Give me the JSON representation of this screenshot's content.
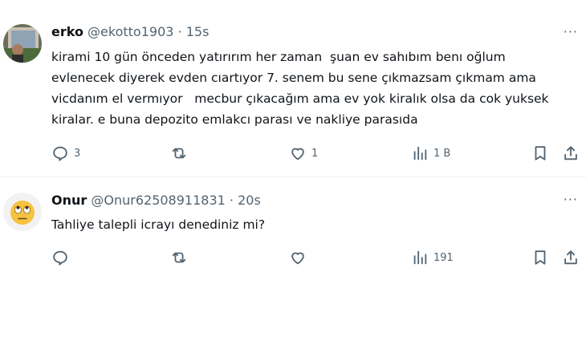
{
  "tweets": [
    {
      "name": "erko",
      "handle": "@ekotto1903",
      "separator": "·",
      "time": "15s",
      "text": "kirami 10 gün önceden yatırırım her zaman  şuan ev sahıbım benı oğlum evlenecek diyerek evden cıartıyor 7. senem bu sene çıkmazsam çıkmam ama vicdanım el vermıyor   mecbur çıkacağım ama ev yok kiralık olsa da cok yuksek kiralar. e buna depozito emlakcı parası ve nakliye parasıda",
      "replies": "3",
      "retweets": "",
      "likes": "1",
      "views": "1 B",
      "more": "···",
      "icons": {
        "reply": "reply-icon",
        "retweet": "retweet-icon",
        "like": "heart-icon",
        "views": "views-icon",
        "bookmark": "bookmark-icon",
        "share": "share-icon"
      }
    },
    {
      "name": "Onur",
      "handle": "@Onur62508911831",
      "separator": "·",
      "time": "20s",
      "text": "Tahliye talepli icrayı denediniz mi?",
      "replies": "",
      "retweets": "",
      "likes": "",
      "views": "191",
      "more": "···",
      "avatar_emoji": "🙄",
      "icons": {
        "reply": "reply-icon",
        "retweet": "retweet-icon",
        "like": "heart-icon",
        "views": "views-icon",
        "bookmark": "bookmark-icon",
        "share": "share-icon"
      }
    }
  ],
  "colors": {
    "text": "#0f1419",
    "secondary": "#536471",
    "divider": "#eff3f4",
    "emoji_face": "#f6c240"
  }
}
